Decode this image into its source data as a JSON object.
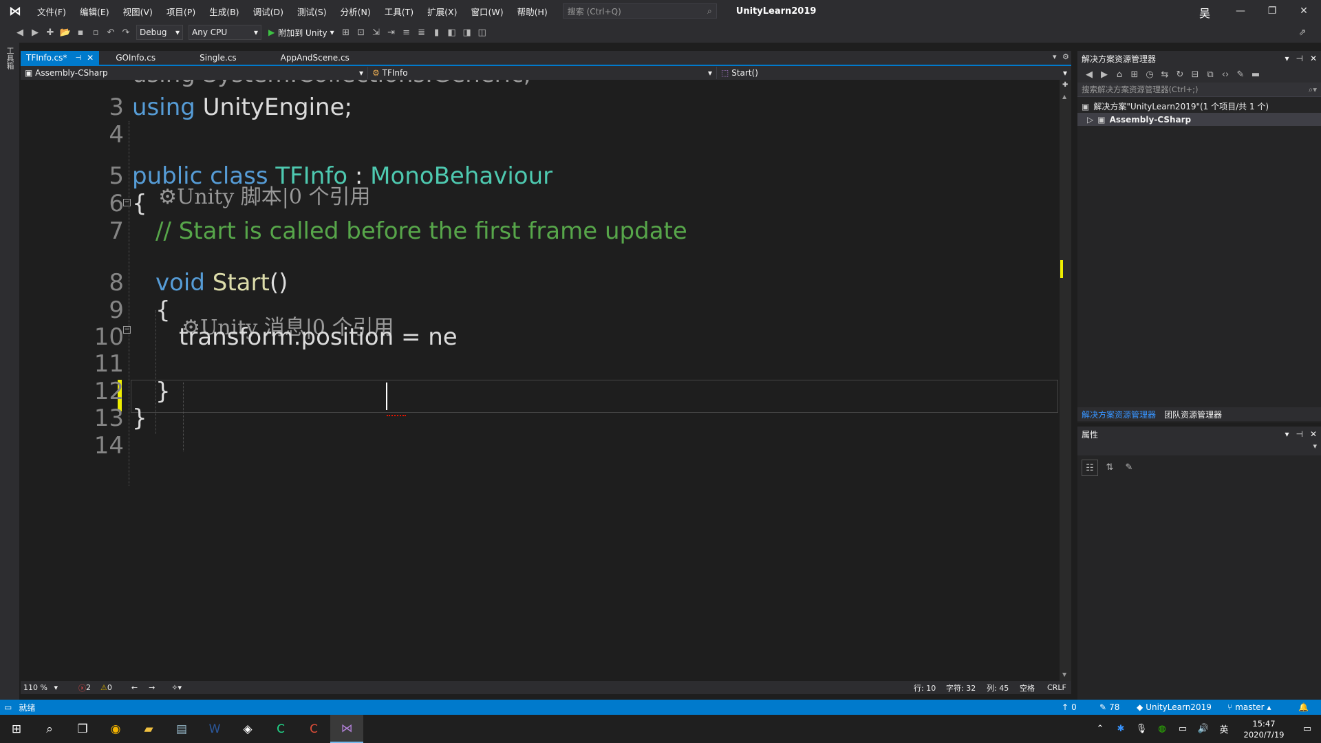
{
  "title_bar": {
    "menus": [
      "文件(F)",
      "编辑(E)",
      "视图(V)",
      "项目(P)",
      "生成(B)",
      "调试(D)",
      "测试(S)",
      "分析(N)",
      "工具(T)",
      "扩展(X)",
      "窗口(W)",
      "帮助(H)"
    ],
    "search_placeholder": "搜索 (Ctrl+Q)",
    "app_title": "UnityLearn2019",
    "user_initial": "吴"
  },
  "toolbar": {
    "config": "Debug",
    "platform": "Any CPU",
    "attach_label": "附加到 Unity"
  },
  "left_strip": {
    "toolbox": "工具箱"
  },
  "tabs": [
    {
      "label": "TFInfo.cs*",
      "active": true
    },
    {
      "label": "GOInfo.cs",
      "active": false
    },
    {
      "label": "Single.cs",
      "active": false
    },
    {
      "label": "AppAndScene.cs",
      "active": false
    }
  ],
  "navbar": {
    "project": "Assembly-CSharp",
    "class": "TFInfo",
    "member": "Start()"
  },
  "editor": {
    "lines": [
      {
        "no": "3",
        "tokens": [
          [
            "kw",
            "using"
          ],
          [
            "plain",
            " UnityEngine;"
          ]
        ]
      },
      {
        "no": "4",
        "tokens": []
      },
      {
        "no": "5",
        "tokens": [
          [
            "kw",
            "public"
          ],
          [
            "plain",
            " "
          ],
          [
            "kw",
            "class"
          ],
          [
            "plain",
            " "
          ],
          [
            "type",
            "TFInfo"
          ],
          [
            "plain",
            " : "
          ],
          [
            "type",
            "MonoBehaviour"
          ]
        ]
      },
      {
        "no": "6",
        "tokens": [
          [
            "plain",
            "{"
          ]
        ]
      },
      {
        "no": "7",
        "tokens": [
          [
            "comment",
            "// Start is called before the first frame update"
          ]
        ]
      },
      {
        "no": "8",
        "tokens": [
          [
            "kw",
            "void"
          ],
          [
            "plain",
            " "
          ],
          [
            "method",
            "Start"
          ],
          [
            "plain",
            "()"
          ]
        ]
      },
      {
        "no": "9",
        "tokens": [
          [
            "plain",
            "{"
          ]
        ]
      },
      {
        "no": "10",
        "tokens": [
          [
            "plain",
            "transform.position = ne"
          ]
        ]
      },
      {
        "no": "11",
        "tokens": []
      },
      {
        "no": "12",
        "tokens": [
          [
            "plain",
            "}"
          ]
        ]
      },
      {
        "no": "13",
        "tokens": [
          [
            "plain",
            "}"
          ]
        ]
      },
      {
        "no": "14",
        "tokens": []
      }
    ],
    "partial_line": "using System.Collections.Generic;",
    "codelens_class": "Unity 脚本|0 个引用",
    "codelens_method": "Unity 消息|0 个引用"
  },
  "editor_status": {
    "zoom": "110 %",
    "errors": "2",
    "warnings": "0",
    "line": "行: 10",
    "char": "字符: 32",
    "col": "列: 45",
    "indent": "空格",
    "eol": "CRLF"
  },
  "solution_explorer": {
    "title": "解决方案资源管理器",
    "search_placeholder": "搜索解决方案资源管理器(Ctrl+;)",
    "solution_row": "解决方案\"UnityLearn2019\"(1 个项目/共 1 个)",
    "project_row": "Assembly-CSharp",
    "tab_solution": "解决方案资源管理器",
    "tab_team": "团队资源管理器"
  },
  "properties": {
    "title": "属性"
  },
  "status_bar": {
    "ready": "就绪",
    "up_count": "0",
    "pencil_count": "78",
    "repo": "UnityLearn2019",
    "branch": "master"
  },
  "taskbar": {
    "ime": "英",
    "time": "15:47",
    "date": "2020/7/19"
  },
  "colors": {
    "accent": "#007acc",
    "keyword": "#569cd6",
    "type": "#4ec9b0",
    "comment": "#57a64a"
  }
}
